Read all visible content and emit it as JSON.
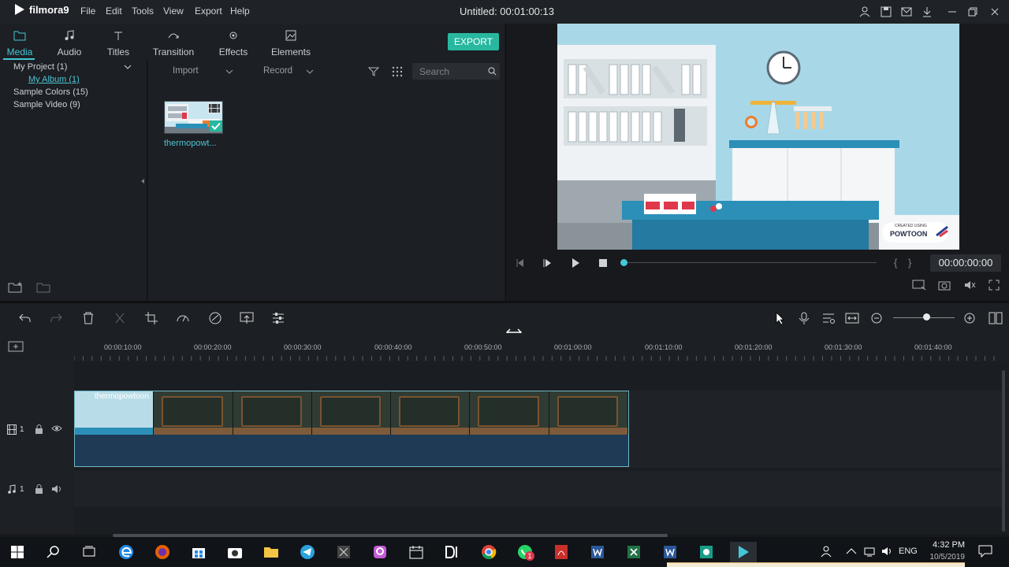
{
  "app": {
    "name": "filmora9",
    "window_title": "Untitled: 00:01:00:13"
  },
  "menu": [
    "File",
    "Edit",
    "Tools",
    "View",
    "Export",
    "Help"
  ],
  "tabs": [
    {
      "label": "Media",
      "icon": "folder-icon",
      "active": true
    },
    {
      "label": "Audio",
      "icon": "music-note-icon",
      "active": false
    },
    {
      "label": "Titles",
      "icon": "title-icon",
      "active": false
    },
    {
      "label": "Transition",
      "icon": "transition-icon",
      "active": false
    },
    {
      "label": "Effects",
      "icon": "effects-icon",
      "active": false
    },
    {
      "label": "Elements",
      "icon": "image-icon",
      "active": false
    }
  ],
  "export_label": "EXPORT",
  "library": {
    "project": "My Project (1)",
    "album": "My Album (1)",
    "sample_colors": "Sample Colors (15)",
    "sample_video": "Sample Video (9)"
  },
  "media_toolbar": {
    "import": "Import",
    "record": "Record",
    "search_placeholder": "Search"
  },
  "media_item": {
    "name": "thermopowt..."
  },
  "preview": {
    "timecode": "00:00:00:00",
    "progress": 0.0,
    "watermark": "POWTOON",
    "watermark_small": "CREATED USING"
  },
  "ruler": [
    "00:00:10:00",
    "00:00:20:00",
    "00:00:30:00",
    "00:00:40:00",
    "00:00:50:00",
    "00:01:00:00",
    "00:01:10:00",
    "00:01:20:00",
    "00:01:30:00",
    "00:01:40:00"
  ],
  "tracks": {
    "video": {
      "number": "1",
      "clip_label": "thermopowtoon"
    },
    "audio": {
      "number": "1"
    }
  },
  "zoom_level": 0.55,
  "taskbar": {
    "time": "4:32 PM",
    "date": "10/5/2019",
    "lang": "ENG",
    "notification_count": "1"
  },
  "colors": {
    "accent": "#44c7d6",
    "export": "#28b89f"
  }
}
